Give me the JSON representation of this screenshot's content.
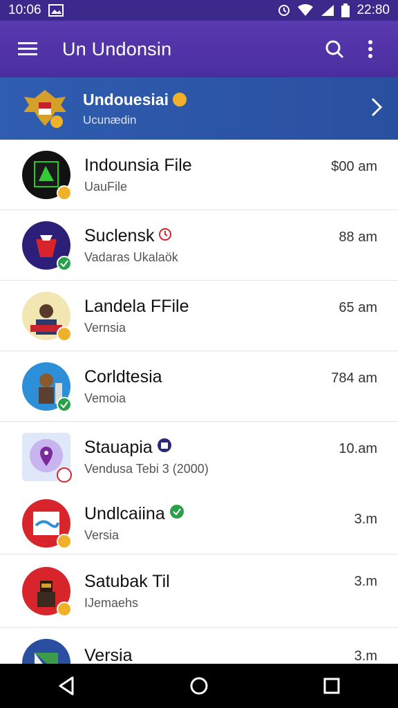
{
  "status_bar": {
    "time_left": "10:06",
    "time_right": "22:80"
  },
  "app_bar": {
    "title": "Un Undonsin"
  },
  "banner": {
    "title": "Undouesiai",
    "subtitle": "Ucunædin"
  },
  "items": [
    {
      "title": "Indounsia File",
      "subtitle": "UauFile",
      "time": "$00 am"
    },
    {
      "title": "Suclensk",
      "subtitle": "Vadaras Ukalaök",
      "time": "88 am"
    },
    {
      "title": "Landela FFile",
      "subtitle": "Vernsia",
      "time": "65 am"
    },
    {
      "title": "Corldtesia",
      "subtitle": "Vemoia",
      "time": "784 am"
    },
    {
      "title": "Stauapia",
      "subtitle": "Vendusa Tebi 3 (2000)",
      "time": "10.am"
    },
    {
      "title": "Undlcaiina",
      "subtitle": "Versia",
      "time": "3.m"
    },
    {
      "title": "Satubak Til",
      "subtitle": "IJemaehs",
      "time": "3.m"
    },
    {
      "title": "Versia",
      "subtitle": "",
      "time": "3.m"
    }
  ],
  "icons": {
    "status": [
      "image-icon",
      "alarm-icon",
      "wifi-icon",
      "signal-icon",
      "battery-icon"
    ],
    "app_bar": [
      "menu-icon",
      "search-icon",
      "more-vert-icon"
    ],
    "nav": [
      "back-icon",
      "home-icon",
      "recents-icon"
    ]
  },
  "colors": {
    "status_bar": "#3b2a8c",
    "app_bar": "#5a3ab0",
    "banner": "#2f5db0",
    "nav_bar": "#000000"
  }
}
